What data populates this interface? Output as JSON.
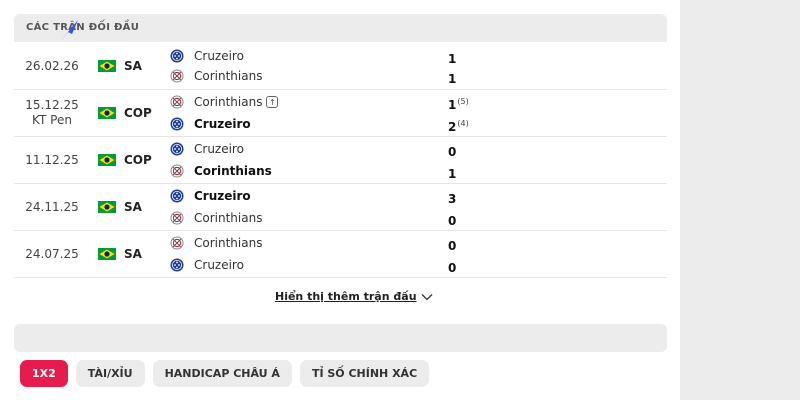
{
  "section_title": "CÁC TRẬN ĐỐI ĐẦU",
  "matches": [
    {
      "date1": "26.02.26",
      "date2": "",
      "competition": "SA",
      "home": "Cruzeiro",
      "away": "Corinthians",
      "home_score": "1",
      "away_score": "1",
      "home_sup": "",
      "away_sup": "",
      "home_crest": "cruzeiro-crest",
      "away_crest": "corinthians-crest"
    },
    {
      "date1": "15.12.25",
      "date2": "KT Pen",
      "competition": "COP",
      "home": "Corinthians",
      "away": "Cruzeiro",
      "home_score": "1",
      "away_score": "2",
      "home_sup": "(5)",
      "away_sup": "(4)",
      "home_crest": "corinthians-crest",
      "away_crest": "cruzeiro-crest"
    },
    {
      "date1": "11.12.25",
      "date2": "",
      "competition": "COP",
      "home": "Cruzeiro",
      "away": "Corinthians",
      "home_score": "0",
      "away_score": "1",
      "home_sup": "",
      "away_sup": "",
      "home_crest": "cruzeiro-crest",
      "away_crest": "corinthians-crest"
    },
    {
      "date1": "24.11.25",
      "date2": "",
      "competition": "SA",
      "home": "Cruzeiro",
      "away": "Corinthians",
      "home_score": "3",
      "away_score": "0",
      "home_sup": "",
      "away_sup": "",
      "home_crest": "cruzeiro-crest",
      "away_crest": "corinthians-crest"
    },
    {
      "date1": "24.07.25",
      "date2": "",
      "competition": "SA",
      "home": "Corinthians",
      "away": "Cruzeiro",
      "home_score": "0",
      "away_score": "0",
      "home_sup": "",
      "away_sup": "",
      "home_crest": "corinthians-crest",
      "away_crest": "cruzeiro-crest"
    }
  ],
  "show_more_label": "Hiển thị thêm trận đấu",
  "tabs": [
    {
      "label": "1X2",
      "active": true
    },
    {
      "label": "TÀI/XỈU",
      "active": false
    },
    {
      "label": "HANDICAP CHÂU Á",
      "active": false
    },
    {
      "label": "TỈ SỐ CHÍNH XÁC",
      "active": false
    }
  ],
  "colors": {
    "accent": "#e51c4d",
    "cruzeiro": "#1c3f94",
    "brazil_green": "#009c3b",
    "brazil_yellow": "#ffdf00"
  }
}
